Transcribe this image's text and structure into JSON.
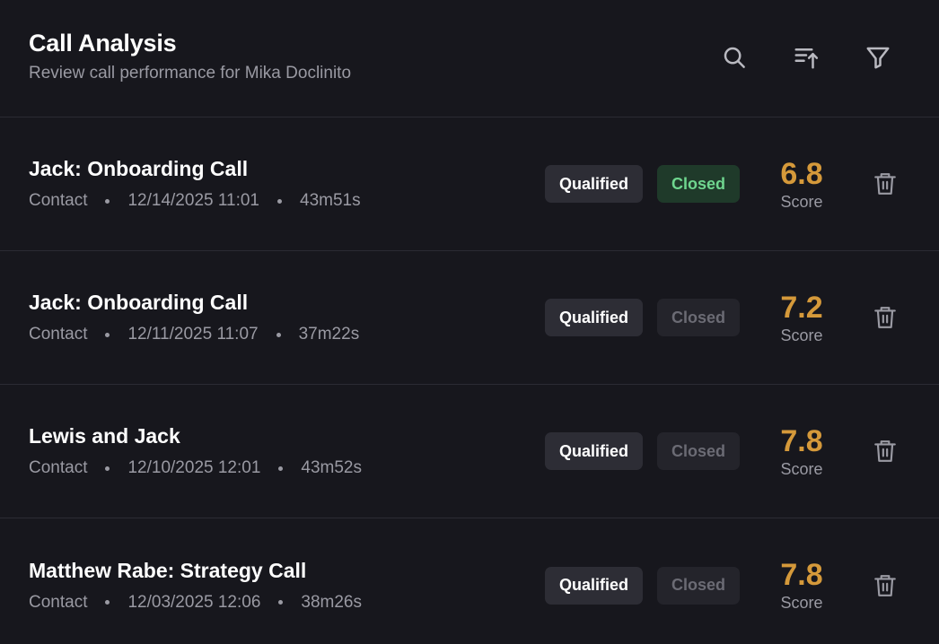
{
  "header": {
    "title": "Call Analysis",
    "subtitle": "Review call performance for Mika Doclinito",
    "tools": [
      {
        "icon": "search-icon"
      },
      {
        "icon": "sort-ascending-icon"
      },
      {
        "icon": "filter-icon"
      }
    ]
  },
  "calls": [
    {
      "title": "Jack: Onboarding Call",
      "type": "Contact",
      "datetime": "12/14/2025 11:01",
      "duration": "43m51s",
      "qualified_label": "Qualified",
      "closed_label": "Closed",
      "closed_active": true,
      "score": "6.8",
      "score_label": "Score"
    },
    {
      "title": "Jack: Onboarding Call",
      "type": "Contact",
      "datetime": "12/11/2025 11:07",
      "duration": "37m22s",
      "qualified_label": "Qualified",
      "closed_label": "Closed",
      "closed_active": false,
      "score": "7.2",
      "score_label": "Score"
    },
    {
      "title": "Lewis and Jack",
      "type": "Contact",
      "datetime": "12/10/2025 12:01",
      "duration": "43m52s",
      "qualified_label": "Qualified",
      "closed_label": "Closed",
      "closed_active": false,
      "score": "7.8",
      "score_label": "Score"
    },
    {
      "title": "Matthew Rabe: Strategy Call",
      "type": "Contact",
      "datetime": "12/03/2025 12:06",
      "duration": "38m26s",
      "qualified_label": "Qualified",
      "closed_label": "Closed",
      "closed_active": false,
      "score": "7.8",
      "score_label": "Score"
    }
  ],
  "colors": {
    "background": "#17171d",
    "score": "#d5993a",
    "closed_active_text": "#6fd68f",
    "closed_active_bg": "#1f3a2a"
  }
}
